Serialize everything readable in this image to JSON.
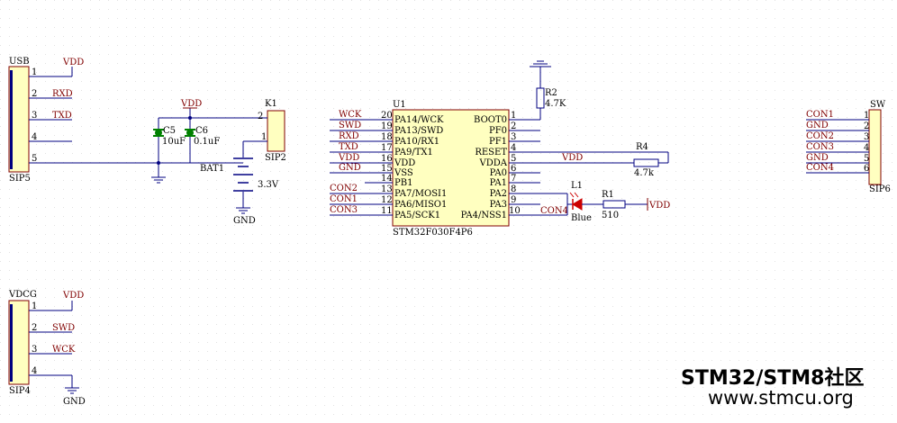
{
  "colors": {
    "wire": "#000080",
    "component_body": "#ffffc0",
    "component_border": "#800000",
    "net_label": "#800000",
    "cap": "#008000",
    "led": "#cc0000",
    "watermark": "#6f9fd0"
  },
  "usb": {
    "designator": "USB",
    "footprint": "SIP5",
    "pins": [
      "1",
      "2",
      "3",
      "4",
      "5"
    ],
    "nets": [
      "VDD",
      "RXD",
      "TXD",
      "",
      ""
    ]
  },
  "power": {
    "vdd": "VDD",
    "c5": {
      "name": "C5",
      "value": "10uF"
    },
    "c6": {
      "name": "C6",
      "value": "0.1uF"
    },
    "k1": {
      "name": "K1",
      "footprint": "SIP2",
      "pin1": "1",
      "pin2": "2"
    },
    "bat": {
      "name": "BAT1",
      "value": "3.3V"
    },
    "gnd": "GND"
  },
  "mcu": {
    "designator": "U1",
    "part": "STM32F030F4P6",
    "left_pins": [
      {
        "num": "20",
        "name": "PA14/WCK",
        "net": "WCK"
      },
      {
        "num": "19",
        "name": "PA13/SWD",
        "net": "SWD"
      },
      {
        "num": "18",
        "name": "PA10/RX1",
        "net": "RXD"
      },
      {
        "num": "17",
        "name": "PA9/TX1",
        "net": "TXD"
      },
      {
        "num": "16",
        "name": "VDD",
        "net": "VDD"
      },
      {
        "num": "15",
        "name": "VSS",
        "net": "GND"
      },
      {
        "num": "14",
        "name": "PB1",
        "net": ""
      },
      {
        "num": "13",
        "name": "PA7/MOSI1",
        "net": "CON2"
      },
      {
        "num": "12",
        "name": "PA6/MISO1",
        "net": "CON1"
      },
      {
        "num": "11",
        "name": "PA5/SCK1",
        "net": "CON3"
      }
    ],
    "right_pins": [
      {
        "num": "1",
        "name": "BOOT0"
      },
      {
        "num": "2",
        "name": "PF0"
      },
      {
        "num": "3",
        "name": "PF1"
      },
      {
        "num": "4",
        "name": "RESET"
      },
      {
        "num": "5",
        "name": "VDDA"
      },
      {
        "num": "6",
        "name": "PA0"
      },
      {
        "num": "7",
        "name": "PA1"
      },
      {
        "num": "8",
        "name": "PA2"
      },
      {
        "num": "9",
        "name": "PA3"
      },
      {
        "num": "10",
        "name": "PA4/NSS1"
      }
    ],
    "vdda_net": "VDD",
    "pa4_net": "CON4"
  },
  "r2": {
    "name": "R2",
    "value": "4.7K"
  },
  "r4": {
    "name": "R4",
    "value": "4.7k"
  },
  "r1": {
    "name": "R1",
    "value": "510"
  },
  "l1": {
    "name": "L1",
    "value": "Blue"
  },
  "led_vdd": "VDD",
  "sw": {
    "designator": "SW",
    "footprint": "SIP6",
    "pins": [
      "1",
      "2",
      "3",
      "4",
      "5",
      "6"
    ],
    "nets": [
      "CON1",
      "GND",
      "CON2",
      "CON3",
      "GND",
      "CON4"
    ]
  },
  "vdcg": {
    "designator": "VDCG",
    "footprint": "SIP4",
    "pins": [
      "1",
      "2",
      "3",
      "4"
    ],
    "nets": [
      "VDD",
      "SWD",
      "WCK",
      "GND"
    ]
  },
  "watermark": {
    "line1": "STM32/STM8社区",
    "line2": "www.stmcu.org"
  }
}
